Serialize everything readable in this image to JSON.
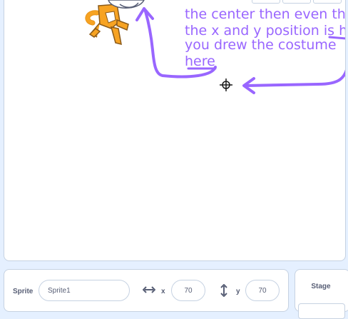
{
  "annotation": {
    "lines": [
      "the center then even tho",
      "the x and y position is he",
      "you drew the costume",
      "here"
    ],
    "color": "#9966ff"
  },
  "sprite_info": {
    "sprite_label": "Sprite",
    "sprite_name": "Sprite1",
    "x_label": "x",
    "x_value": "70",
    "y_label": "y",
    "y_value": "70"
  },
  "stage_panel": {
    "title": "Stage"
  },
  "icons": {
    "crosshair": "crosshair-icon",
    "x_arrows": "horizontal-arrows-icon",
    "y_arrows": "vertical-arrows-icon",
    "sprite": "cat-sprite"
  }
}
